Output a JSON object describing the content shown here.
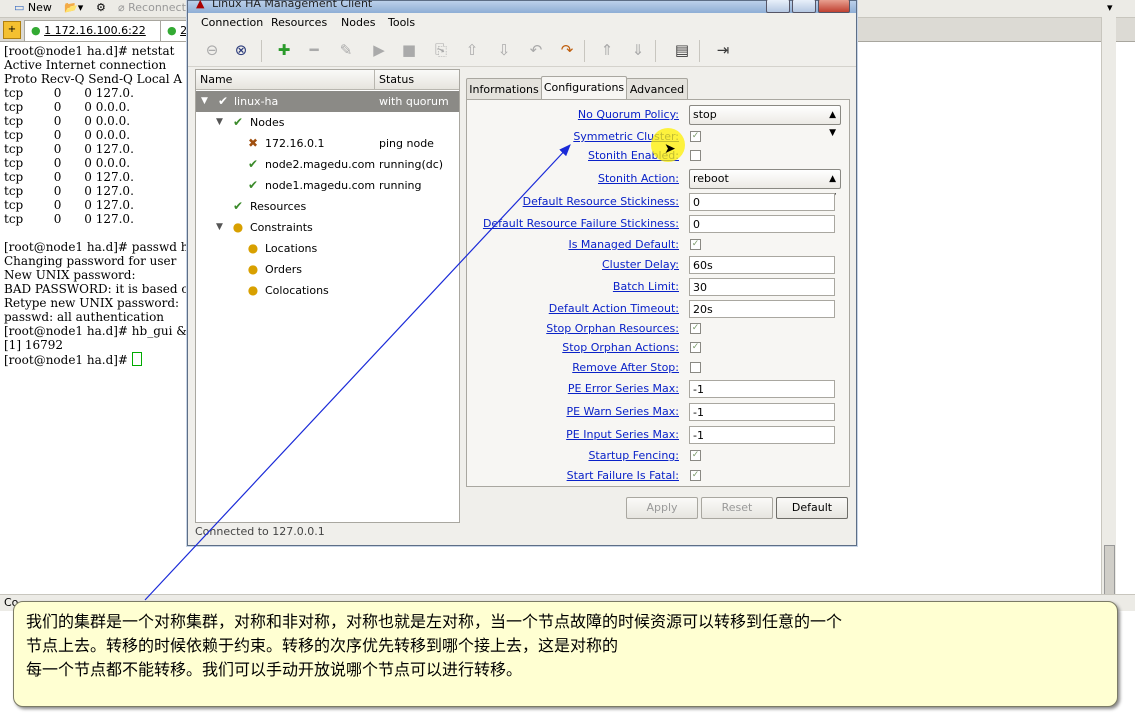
{
  "bg_toolbar": {
    "new_label": "New",
    "reconnect_label": "Reconnect"
  },
  "bg_tabs": [
    {
      "label": "1 172.16.100.6:22"
    },
    {
      "label": "2"
    }
  ],
  "terminal": {
    "lines": [
      "[root@node1 ha.d]# netstat",
      "Active Internet connection",
      "Proto Recv-Q Send-Q Local A",
      "tcp        0      0 127.0.",
      "tcp        0      0 0.0.0.",
      "tcp        0      0 0.0.0.",
      "tcp        0      0 0.0.0.",
      "tcp        0      0 127.0.",
      "tcp        0      0 0.0.0.",
      "tcp        0      0 127.0.",
      "tcp        0      0 127.0.",
      "tcp        0      0 127.0.",
      "tcp        0      0 127.0.",
      "[root@node1 ha.d]# passwd h",
      "Changing password for user",
      "New UNIX password:",
      "BAD PASSWORD: it is based o",
      "Retype new UNIX password:",
      "passwd: all authentication",
      "[root@node1 ha.d]# hb_gui &",
      "[1] 16792",
      "[root@node1 ha.d]# "
    ]
  },
  "bg_status": "Co",
  "window": {
    "title": "Linux HA Management Client",
    "menu": [
      "Connection",
      "Resources",
      "Nodes",
      "Tools"
    ],
    "status_bar": "Connected to 127.0.0.1"
  },
  "tree": {
    "headers": {
      "name": "Name",
      "status": "Status"
    },
    "rows": [
      {
        "name": "linux-ha",
        "status": "with quorum"
      },
      {
        "name": "Nodes",
        "status": ""
      },
      {
        "name": "172.16.0.1",
        "status": "ping node"
      },
      {
        "name": "node2.magedu.com",
        "status": "running(dc)"
      },
      {
        "name": "node1.magedu.com",
        "status": "running"
      },
      {
        "name": "Resources",
        "status": ""
      },
      {
        "name": "Constraints",
        "status": ""
      },
      {
        "name": "Locations",
        "status": ""
      },
      {
        "name": "Orders",
        "status": ""
      },
      {
        "name": "Colocations",
        "status": ""
      }
    ]
  },
  "tabs": [
    "Informations",
    "Configurations",
    "Advanced"
  ],
  "config": {
    "no_quorum_policy": {
      "label": "No Quorum Policy:",
      "value": "stop"
    },
    "symmetric_cluster": {
      "label": "Symmetric Cluster:",
      "checked": true
    },
    "stonith_enabled": {
      "label": "Stonith Enabled:",
      "checked": false
    },
    "stonith_action": {
      "label": "Stonith Action:",
      "value": "reboot"
    },
    "default_resource_stickiness": {
      "label": "Default Resource Stickiness:",
      "value": "0"
    },
    "default_resource_failure_stickiness": {
      "label": "Default Resource Failure Stickiness:",
      "value": "0"
    },
    "is_managed_default": {
      "label": "Is Managed Default:",
      "checked": true
    },
    "cluster_delay": {
      "label": "Cluster Delay:",
      "value": "60s"
    },
    "batch_limit": {
      "label": "Batch Limit:",
      "value": "30"
    },
    "default_action_timeout": {
      "label": "Default Action Timeout:",
      "value": "20s"
    },
    "stop_orphan_resources": {
      "label": "Stop Orphan Resources:",
      "checked": true
    },
    "stop_orphan_actions": {
      "label": "Stop Orphan Actions:",
      "checked": true
    },
    "remove_after_stop": {
      "label": "Remove After Stop:",
      "checked": false
    },
    "pe_error_series_max": {
      "label": "PE Error Series Max:",
      "value": "-1"
    },
    "pe_warn_series_max": {
      "label": "PE Warn Series Max:",
      "value": "-1"
    },
    "pe_input_series_max": {
      "label": "PE Input Series Max:",
      "value": "-1"
    },
    "startup_fencing": {
      "label": "Startup Fencing:",
      "checked": true
    },
    "start_failure_is_fatal": {
      "label": "Start Failure Is Fatal:",
      "checked": true
    }
  },
  "buttons": {
    "apply": "Apply",
    "reset": "Reset",
    "default": "Default"
  },
  "caption": {
    "lines": [
      "我们的集群是一个对称集群，对称和非对称，对称也就是左对称，当一个节点故障的时候资源可以转移到任意的一个",
      "节点上去。转移的时候依赖于约束。转移的次序优先转移到哪个接上去，这是对称的",
      "每一个节点都不能转移。我们可以手动开放说哪个节点可以进行转移。"
    ]
  },
  "colors": {
    "link": "#0a22c8",
    "highlight": "#fff000",
    "caption_bg": "#ffffd2",
    "selection": "#8b8a86"
  }
}
